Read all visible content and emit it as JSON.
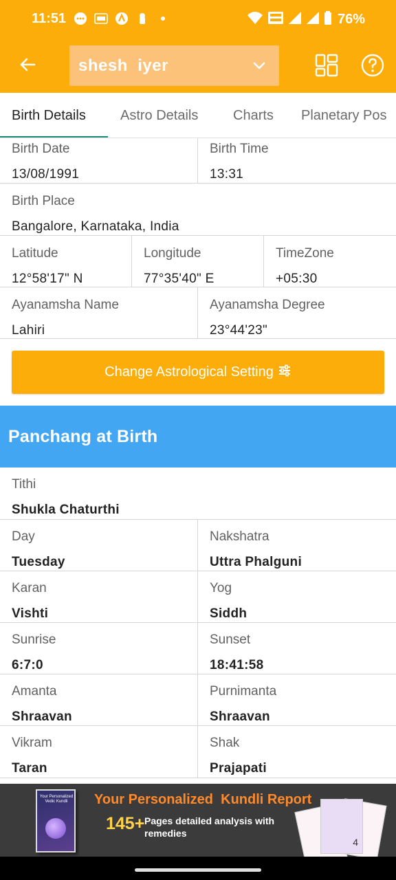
{
  "status_bar": {
    "time": "11:51",
    "battery": "76%",
    "left_icons": [
      "chat-bubble-icon",
      "temu-icon",
      "app-icon",
      "keyhole-icon",
      "dot-icon"
    ],
    "right_icons": [
      "wifi-icon",
      "vowifi-icon",
      "signal-icon",
      "signal-icon",
      "battery-icon"
    ]
  },
  "app_bar": {
    "profile_name": "shesh  iyer",
    "back_icon": "arrow-left-icon",
    "chevron_icon": "chevron-down-icon",
    "grid_icon": "dashboard-grid-icon",
    "help_icon": "question-circle-icon"
  },
  "tabs": [
    {
      "label": "Birth Details",
      "active": true
    },
    {
      "label": "Astro Details",
      "active": false
    },
    {
      "label": "Charts",
      "active": false
    },
    {
      "label": "Planetary Pos",
      "active": false
    }
  ],
  "birth": {
    "birth_date": {
      "label": "Birth Date",
      "value": "13/08/1991"
    },
    "birth_time": {
      "label": "Birth Time",
      "value": "13:31"
    },
    "birth_place": {
      "label": "Birth Place",
      "value": "Bangalore, Karnataka, India"
    },
    "latitude": {
      "label": "Latitude",
      "value": "12°58'17\" N"
    },
    "longitude": {
      "label": "Longitude",
      "value": "77°35'40\" E"
    },
    "timezone": {
      "label": "TimeZone",
      "value": "+05:30"
    },
    "ayanamsha_name": {
      "label": "Ayanamsha Name",
      "value": "Lahiri"
    },
    "ayanamsha_degree": {
      "label": "Ayanamsha Degree",
      "value": "23°44'23\""
    }
  },
  "change_button": {
    "label": "Change Astrological Setting",
    "icon": "sliders-icon"
  },
  "panchang": {
    "title": "Panchang at Birth",
    "tithi": {
      "label": "Tithi",
      "value": "Shukla Chaturthi"
    },
    "day": {
      "label": "Day",
      "value": "Tuesday"
    },
    "nakshatra": {
      "label": "Nakshatra",
      "value": "Uttra Phalguni"
    },
    "karan": {
      "label": "Karan",
      "value": "Vishti"
    },
    "yog": {
      "label": "Yog",
      "value": "Siddh"
    },
    "sunrise": {
      "label": "Sunrise",
      "value": "6:7:0"
    },
    "sunset": {
      "label": "Sunset",
      "value": "18:41:58"
    },
    "amanta": {
      "label": "Amanta",
      "value": "Shraavan"
    },
    "purnimanta": {
      "label": "Purnimanta",
      "value": "Shraavan"
    },
    "vikram": {
      "label": "Vikram",
      "value": "Taran"
    },
    "shak": {
      "label": "Shak",
      "value": "Prajapati"
    }
  },
  "banner": {
    "title": "Your Personalized  Kundli Report",
    "count": "145+",
    "subtitle": "Pages detailed analysis with remedies",
    "book_title": "Your Personalized Vedic Kundli",
    "doc_number": "4"
  },
  "colors": {
    "primary": "#fcad0a",
    "panchang_header": "#42a6f2",
    "tab_indicator": "#1f8a7b",
    "banner_bg": "#3b3b3b",
    "banner_title": "#ff8a2b"
  }
}
